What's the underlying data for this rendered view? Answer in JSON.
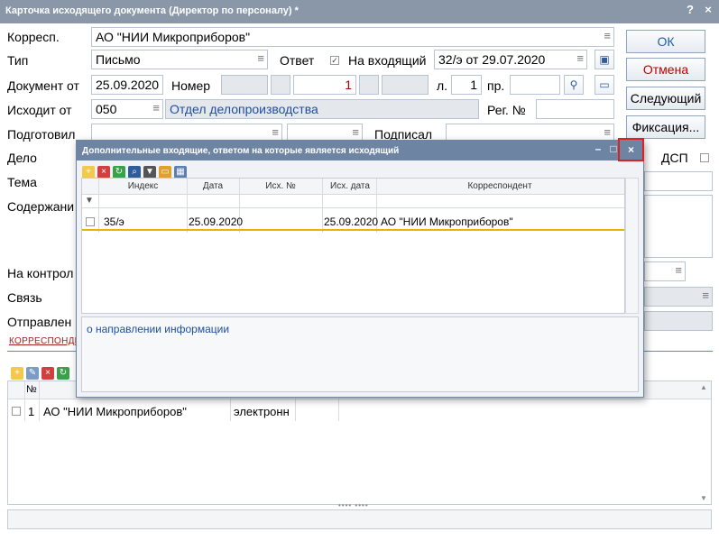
{
  "window": {
    "title": "Карточка исходящего документа (Директор по персоналу) *",
    "help": "?",
    "close": "×"
  },
  "form": {
    "corresp_label": "Корресп.",
    "corresp_value": "АО \"НИИ Микроприборов\"",
    "type_label": "Тип",
    "type_value": "Письмо",
    "answer_label": "Ответ",
    "answer_checked": "✓",
    "incoming_label": "На входящий",
    "incoming_value": "32/э от 29.07.2020",
    "doc_from_label": "Документ от",
    "doc_date": "25.09.2020",
    "number_label": "Номер",
    "number_value": "1",
    "sheets_label": "л.",
    "sheets_value": "1",
    "appendix_label": "пр.",
    "out_from_label": "Исходит от",
    "dept_code": "050",
    "dept_name": "Отдел делопроизводства",
    "reg_label": "Рег. №",
    "prepared_label": "Подготовил",
    "signed_label": "Подписал",
    "case_label": "Дело",
    "dsp_label": "ДСП",
    "topic_label": "Тема",
    "content_label": "Содержани",
    "control_label": "На контрол",
    "link_label": "Связь",
    "sent_label": "Отправлен"
  },
  "buttons": {
    "ok": "ОК",
    "cancel": "Отмена",
    "next": "Следующий",
    "fix": "Фиксация..."
  },
  "tabs": {
    "correspondents": "КОРРЕСПОНДЕНТ"
  },
  "recipients": {
    "num_header": "№",
    "rows": [
      {
        "num": "1",
        "name": "АО \"НИИ Микроприборов\"",
        "delivery": "электронн"
      }
    ]
  },
  "dialog": {
    "title": "Дополнительные входящие, ответом на которые является исходящий",
    "columns": [
      "Индекс",
      "Дата",
      "Исх. №",
      "Исх. дата",
      "Корреспондент"
    ],
    "rows": [
      {
        "index": "35/э",
        "date": "25.09.2020",
        "out_no": "",
        "out_date": "25.09.2020",
        "correspondent": "АО \"НИИ Микроприборов\""
      }
    ],
    "note": "о направлении информации",
    "close": "×",
    "minimize": "–",
    "maximize": "□"
  },
  "icons": {
    "grip": "•••• ••••"
  }
}
